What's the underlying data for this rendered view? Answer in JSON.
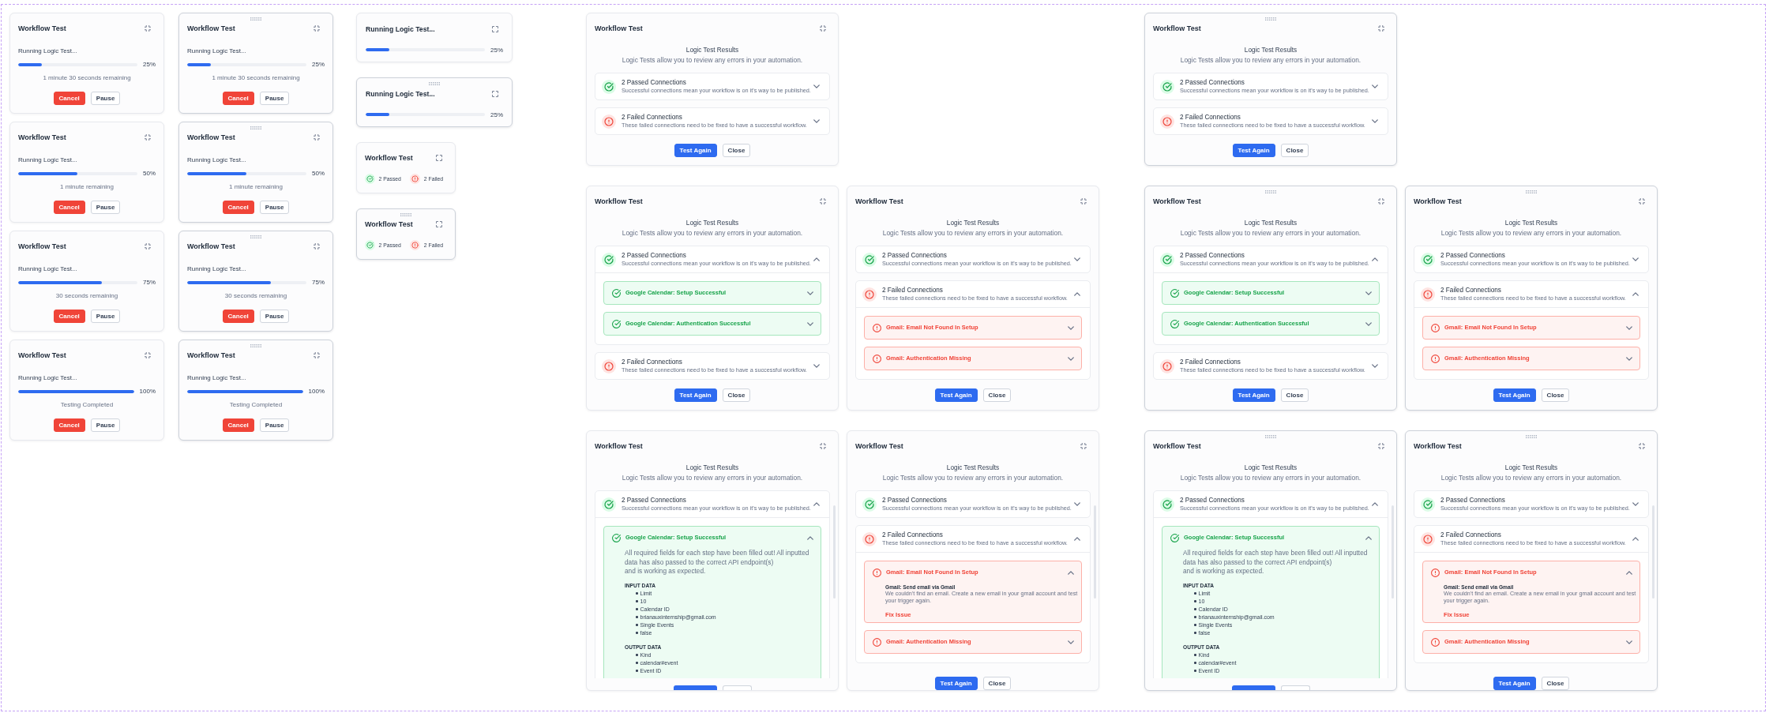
{
  "progress_cards": [
    {
      "title": "Workflow Test",
      "handle": false,
      "status": "Running Logic Test...",
      "level": 0.2,
      "percent": "25%",
      "remaining": "1 minute 30 seconds remaining",
      "buttons": [
        {
          "label": "Cancel",
          "kind": "cancel"
        },
        {
          "label": "Pause",
          "kind": "pause"
        }
      ]
    },
    {
      "title": "Workflow Test",
      "handle": true,
      "status": "Running Logic Test...",
      "level": 0.2,
      "percent": "25%",
      "remaining": "1 minute 30 seconds remaining",
      "buttons": [
        {
          "label": "Cancel",
          "kind": "cancel"
        },
        {
          "label": "Pause",
          "kind": "pause"
        }
      ]
    },
    {
      "title": "Workflow Test",
      "handle": false,
      "status": "Running Logic Test...",
      "level": 0.5,
      "percent": "50%",
      "remaining": "1 minute remaining",
      "buttons": [
        {
          "label": "Cancel",
          "kind": "cancel"
        },
        {
          "label": "Pause",
          "kind": "pause"
        }
      ]
    },
    {
      "title": "Workflow Test",
      "handle": true,
      "status": "Running Logic Test...",
      "level": 0.5,
      "percent": "50%",
      "remaining": "1 minute remaining",
      "buttons": [
        {
          "label": "Cancel",
          "kind": "cancel"
        },
        {
          "label": "Pause",
          "kind": "pause"
        }
      ]
    },
    {
      "title": "Workflow Test",
      "handle": false,
      "status": "Running Logic Test...",
      "level": 0.7,
      "percent": "75%",
      "remaining": "30 seconds remaining",
      "buttons": [
        {
          "label": "Cancel",
          "kind": "cancel"
        },
        {
          "label": "Pause",
          "kind": "pause"
        }
      ]
    },
    {
      "title": "Workflow Test",
      "handle": true,
      "status": "Running Logic Test...",
      "level": 0.7,
      "percent": "75%",
      "remaining": "30 seconds remaining",
      "buttons": [
        {
          "label": "Cancel",
          "kind": "cancel"
        },
        {
          "label": "Pause",
          "kind": "pause"
        }
      ]
    },
    {
      "title": "Workflow Test",
      "handle": false,
      "status": "Running Logic Test...",
      "level": 1,
      "percent": "100%",
      "remaining": "Testing Completed",
      "buttons": [
        {
          "label": "Cancel",
          "kind": "cancel"
        },
        {
          "label": "Pause",
          "kind": "pause"
        }
      ]
    },
    {
      "title": "Workflow Test",
      "handle": true,
      "status": "Running Logic Test...",
      "level": 1,
      "percent": "100%",
      "remaining": "Testing Completed",
      "buttons": [
        {
          "label": "Cancel",
          "kind": "cancel"
        },
        {
          "label": "Pause",
          "kind": "pause"
        }
      ]
    }
  ],
  "compact_cards": [
    {
      "kind": "progress",
      "title": "Running Logic Test...",
      "handle": false,
      "level": 0.2,
      "percent": "25%"
    },
    {
      "kind": "progress",
      "title": "Running Logic Test...",
      "handle": true,
      "level": 0.2,
      "percent": "25%"
    },
    {
      "kind": "summary",
      "title": "Workflow Test",
      "handle": false,
      "stats": [
        {
          "kind": "passed",
          "label": "2 Passed"
        },
        {
          "kind": "failed",
          "label": "2 Failed"
        }
      ]
    },
    {
      "kind": "summary",
      "title": "Workflow Test",
      "handle": true,
      "stats": [
        {
          "kind": "passed",
          "label": "2 Passed"
        },
        {
          "kind": "failed",
          "label": "2 Failed"
        }
      ]
    }
  ],
  "result_boards": [
    {
      "rows": [
        [
          {
            "title": "Workflow Test",
            "handle": false,
            "heading": "Logic Test Results",
            "subtitle": "Logic Tests allow you to review any errors in your automation.",
            "scrollbar": false,
            "groups": [
              {
                "kind": "passed",
                "title": "2 Passed Connections",
                "description": "Successful connections mean your workflow is on it's way to be published.",
                "expanded": false
              },
              {
                "kind": "failed",
                "title": "2 Failed Connections",
                "description": "These failed connections need to be fixed to have a successful workflow.",
                "expanded": false
              }
            ],
            "buttons": [
              {
                "label": "Test Again",
                "kind": "test"
              },
              {
                "label": "Close",
                "kind": "close"
              }
            ]
          }
        ],
        [
          {
            "title": "Workflow Test",
            "handle": false,
            "heading": "Logic Test Results",
            "subtitle": "Logic Tests allow you to review any errors in your automation.",
            "scrollbar": false,
            "groups": [
              {
                "kind": "passed",
                "title": "2 Passed Connections",
                "description": "Successful connections mean your workflow is on it's way to be published.",
                "expanded": true,
                "items": [
                  {
                    "kind": "passed",
                    "title": "Google Calendar: Setup Successful",
                    "expanded": false
                  },
                  {
                    "kind": "passed",
                    "title": "Google Calendar: Authentication Successful",
                    "expanded": false
                  }
                ]
              },
              {
                "kind": "failed",
                "title": "2 Failed Connections",
                "description": "These failed connections need to be fixed to have a successful workflow.",
                "expanded": false
              }
            ],
            "buttons": [
              {
                "label": "Test Again",
                "kind": "test"
              },
              {
                "label": "Close",
                "kind": "close"
              }
            ]
          },
          {
            "title": "Workflow Test",
            "handle": false,
            "heading": "Logic Test Results",
            "subtitle": "Logic Tests allow you to review any errors in your automation.",
            "scrollbar": false,
            "groups": [
              {
                "kind": "passed",
                "title": "2 Passed Connections",
                "description": "Successful connections mean your workflow is on it's way to be published.",
                "expanded": false
              },
              {
                "kind": "failed",
                "title": "2 Failed Connections",
                "description": "These failed connections need to be fixed to have a successful workflow.",
                "expanded": true,
                "items": [
                  {
                    "kind": "failed",
                    "title": "Gmail: Email Not Found In Setup",
                    "expanded": false
                  },
                  {
                    "kind": "failed",
                    "title": "Gmail: Authentication Missing",
                    "expanded": false
                  }
                ]
              }
            ],
            "buttons": [
              {
                "label": "Test Again",
                "kind": "test"
              },
              {
                "label": "Close",
                "kind": "close"
              }
            ]
          }
        ],
        [
          {
            "title": "Workflow Test",
            "handle": false,
            "heading": "Logic Test Results",
            "subtitle": "Logic Tests allow you to review any errors in your automation.",
            "scrollbar": true,
            "groups": [
              {
                "kind": "passed",
                "title": "2 Passed Connections",
                "description": "Successful connections mean your workflow is on it's way to be published.",
                "expanded": true,
                "items": [
                  {
                    "kind": "passed",
                    "title": "Google Calendar: Setup Successful",
                    "expanded": true,
                    "description": "All required fields for each step have been filled out! All inputted data has also passed to the correct API endpoint(s)\nand is working as expected.",
                    "sections": [
                      {
                        "heading": "INPUT DATA",
                        "items": [
                          "Limit",
                          "10",
                          "Calendar ID",
                          "brianauxinternship@gmail.com",
                          "Single Events",
                          "false"
                        ]
                      },
                      {
                        "heading": "OUTPUT DATA",
                        "items": [
                          "Kind",
                          "calendar#event",
                          "Event ID"
                        ]
                      }
                    ]
                  }
                ]
              }
            ],
            "buttons": [
              {
                "kind": "test"
              },
              {
                "kind": "close"
              }
            ]
          },
          {
            "title": "Workflow Test",
            "handle": false,
            "heading": "Logic Test Results",
            "subtitle": "Logic Tests allow you to review any errors in your automation.",
            "scrollbar": true,
            "groups": [
              {
                "kind": "passed",
                "title": "2 Passed Connections",
                "description": "Successful connections mean your workflow is on it's way to be published.",
                "expanded": false
              },
              {
                "kind": "failed",
                "title": "2 Failed Connections",
                "description": "These failed connections need to be fixed to have a successful workflow.",
                "expanded": true,
                "items": [
                  {
                    "kind": "failed",
                    "title": "Gmail: Email Not Found In Setup",
                    "expanded": true,
                    "detail_title": "Gmail: Send email via Gmail",
                    "detail": "We couldn't find an email. Create a new email in your gmail account and test your trigger again.",
                    "action": "Fix Issue"
                  },
                  {
                    "kind": "failed",
                    "title": "Gmail: Authentication Missing",
                    "expanded": false
                  }
                ]
              }
            ],
            "buttons": [
              {
                "label": "Test Again",
                "kind": "test"
              },
              {
                "label": "Close",
                "kind": "close"
              }
            ]
          }
        ]
      ]
    },
    {
      "rows": [
        [
          {
            "title": "Workflow Test",
            "handle": true,
            "heading": "Logic Test Results",
            "subtitle": "Logic Tests allow you to review any errors in your automation.",
            "scrollbar": false,
            "groups": [
              {
                "kind": "passed",
                "title": "2 Passed Connections",
                "description": "Successful connections mean your workflow is on it's way to be published.",
                "expanded": false
              },
              {
                "kind": "failed",
                "title": "2 Failed Connections",
                "description": "These failed connections need to be fixed to have a successful workflow.",
                "expanded": false
              }
            ],
            "buttons": [
              {
                "label": "Test Again",
                "kind": "test"
              },
              {
                "label": "Close",
                "kind": "close"
              }
            ]
          }
        ],
        [
          {
            "title": "Workflow Test",
            "handle": true,
            "heading": "Logic Test Results",
            "subtitle": "Logic Tests allow you to review any errors in your automation.",
            "scrollbar": false,
            "groups": [
              {
                "kind": "passed",
                "title": "2 Passed Connections",
                "description": "Successful connections mean your workflow is on it's way to be published.",
                "expanded": true,
                "items": [
                  {
                    "kind": "passed",
                    "title": "Google Calendar: Setup Successful",
                    "expanded": false
                  },
                  {
                    "kind": "passed",
                    "title": "Google Calendar: Authentication Successful",
                    "expanded": false
                  }
                ]
              },
              {
                "kind": "failed",
                "title": "2 Failed Connections",
                "description": "These failed connections need to be fixed to have a successful workflow.",
                "expanded": false
              }
            ],
            "buttons": [
              {
                "label": "Test Again",
                "kind": "test"
              },
              {
                "label": "Close",
                "kind": "close"
              }
            ]
          },
          {
            "title": "Workflow Test",
            "handle": true,
            "heading": "Logic Test Results",
            "subtitle": "Logic Tests allow you to review any errors in your automation.",
            "scrollbar": false,
            "groups": [
              {
                "kind": "passed",
                "title": "2 Passed Connections",
                "description": "Successful connections mean your workflow is on it's way to be published.",
                "expanded": false
              },
              {
                "kind": "failed",
                "title": "2 Failed Connections",
                "description": "These failed connections need to be fixed to have a successful workflow.",
                "expanded": true,
                "items": [
                  {
                    "kind": "failed",
                    "title": "Gmail: Email Not Found In Setup",
                    "expanded": false
                  },
                  {
                    "kind": "failed",
                    "title": "Gmail: Authentication Missing",
                    "expanded": false
                  }
                ]
              }
            ],
            "buttons": [
              {
                "label": "Test Again",
                "kind": "test"
              },
              {
                "label": "Close",
                "kind": "close"
              }
            ]
          }
        ],
        [
          {
            "title": "Workflow Test",
            "handle": true,
            "heading": "Logic Test Results",
            "subtitle": "Logic Tests allow you to review any errors in your automation.",
            "scrollbar": true,
            "groups": [
              {
                "kind": "passed",
                "title": "2 Passed Connections",
                "description": "Successful connections mean your workflow is on it's way to be published.",
                "expanded": true,
                "items": [
                  {
                    "kind": "passed",
                    "title": "Google Calendar: Setup Successful",
                    "expanded": true,
                    "description": "All required fields for each step have been filled out! All inputted data has also passed to the correct API endpoint(s)\nand is working as expected.",
                    "sections": [
                      {
                        "heading": "INPUT DATA",
                        "items": [
                          "Limit",
                          "10",
                          "Calendar ID",
                          "brianauxinternship@gmail.com",
                          "Single Events",
                          "false"
                        ]
                      },
                      {
                        "heading": "OUTPUT DATA",
                        "items": [
                          "Kind",
                          "calendar#event",
                          "Event ID"
                        ]
                      }
                    ]
                  }
                ]
              }
            ],
            "buttons": [
              {
                "kind": "test"
              },
              {
                "kind": "close"
              }
            ]
          },
          {
            "title": "Workflow Test",
            "handle": true,
            "heading": "Logic Test Results",
            "subtitle": "Logic Tests allow you to review any errors in your automation.",
            "scrollbar": true,
            "groups": [
              {
                "kind": "passed",
                "title": "2 Passed Connections",
                "description": "Successful connections mean your workflow is on it's way to be published.",
                "expanded": false
              },
              {
                "kind": "failed",
                "title": "2 Failed Connections",
                "description": "These failed connections need to be fixed to have a successful workflow.",
                "expanded": true,
                "items": [
                  {
                    "kind": "failed",
                    "title": "Gmail: Email Not Found In Setup",
                    "expanded": true,
                    "detail_title": "Gmail: Send email via Gmail",
                    "detail": "We couldn't find an email. Create a new email in your gmail account and test your trigger again.",
                    "action": "Fix Issue"
                  },
                  {
                    "kind": "failed",
                    "title": "Gmail: Authentication Missing",
                    "expanded": false
                  }
                ]
              }
            ],
            "buttons": [
              {
                "label": "Test Again",
                "kind": "test"
              },
              {
                "label": "Close",
                "kind": "close"
              }
            ]
          }
        ]
      ]
    }
  ]
}
